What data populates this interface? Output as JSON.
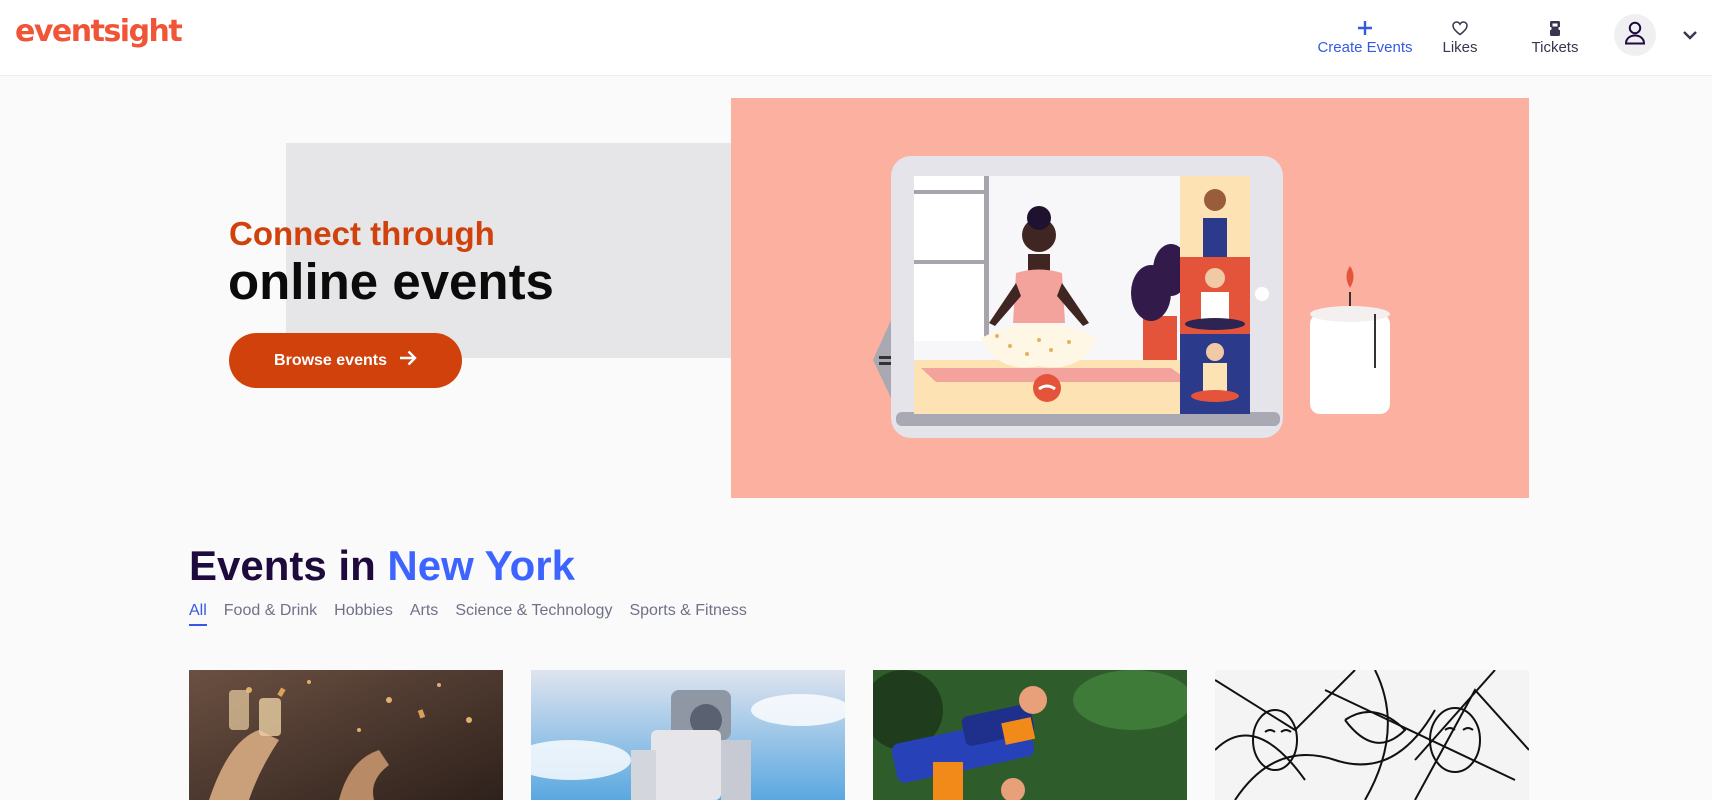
{
  "header": {
    "logo": "eventsight",
    "nav": [
      {
        "label": "Create Events",
        "icon": "plus-icon"
      },
      {
        "label": "Likes",
        "icon": "heart-icon"
      },
      {
        "label": "Tickets",
        "icon": "ticket-icon"
      }
    ],
    "account_icon": "user-icon",
    "menu_icon": "chevron-down-icon"
  },
  "hero": {
    "line1": "Connect through",
    "line2": "online events",
    "button_label": "Browse events",
    "button_icon": "arrow-right-icon",
    "illustration": "online-yoga-illustration"
  },
  "events": {
    "title_prefix": "Events in",
    "city": "New York",
    "tabs": [
      "All",
      "Food & Drink",
      "Hobbies",
      "Arts",
      "Science & Technology",
      "Sports & Fitness"
    ],
    "active_tab": "All"
  },
  "cards": [
    {
      "image": "champagne-toast-image"
    },
    {
      "image": "robot-statue-image"
    },
    {
      "image": "nerf-blaster-image"
    },
    {
      "image": "line-art-faces-image"
    }
  ],
  "colors": {
    "brand": "#f05537",
    "accent_orange": "#d1410c",
    "link_blue": "#3659e3",
    "city_blue": "#3d64ff",
    "hero_salmon": "#fbb0a0"
  }
}
